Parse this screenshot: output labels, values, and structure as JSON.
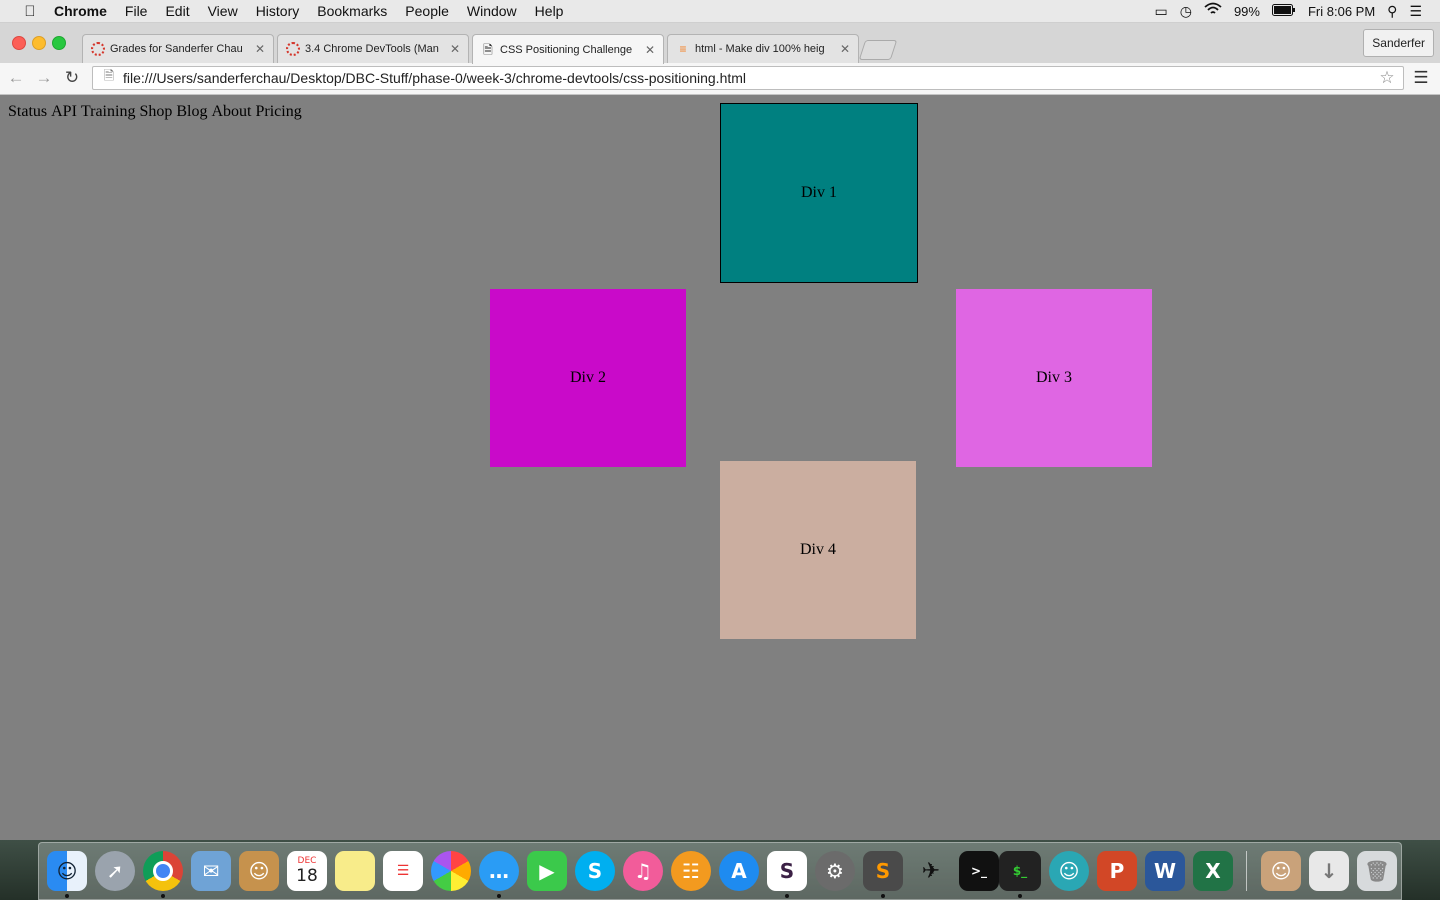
{
  "menubar": {
    "app_name": "Chrome",
    "menus": [
      "File",
      "Edit",
      "View",
      "History",
      "Bookmarks",
      "People",
      "Window",
      "Help"
    ],
    "battery": "99%",
    "clock": "Fri 8:06 PM"
  },
  "browser": {
    "tabs": [
      {
        "title": "Grades for Sanderfer Chau",
        "icon": "ring-icon"
      },
      {
        "title": "3.4 Chrome DevTools (Man",
        "icon": "ring-icon"
      },
      {
        "title": "CSS Positioning Challenge",
        "icon": "page-icon"
      },
      {
        "title": "html - Make div 100% heig",
        "icon": "stackoverflow-icon"
      }
    ],
    "active_tab": 2,
    "profile_name": "Sanderfer",
    "url": "file:///Users/sanderferchau/Desktop/DBC-Stuff/phase-0/week-3/chrome-devtools/css-positioning.html"
  },
  "page": {
    "nav_links": [
      "Status",
      "API",
      "Training",
      "Shop",
      "Blog",
      "About",
      "Pricing"
    ],
    "boxes": {
      "div1": "Div 1",
      "div2": "Div 2",
      "div3": "Div 3",
      "div4": "Div 4"
    },
    "colors": {
      "background": "#808080",
      "div1": "#008080",
      "div2": "#c90ac9",
      "div3": "#df66e3",
      "div4": "#cbaea0"
    }
  },
  "dock": {
    "calendar_month": "DEC",
    "calendar_day": "18",
    "items": [
      "finder-icon",
      "launchpad-icon",
      "chrome-icon",
      "mail-icon",
      "contacts-icon",
      "calendar-icon",
      "notes-icon",
      "reminders-icon",
      "photos-icon",
      "messages-icon",
      "facetime-icon",
      "skype-icon",
      "itunes-icon",
      "ibooks-icon",
      "appstore-icon",
      "slack-icon",
      "system-preferences-icon",
      "sublime-text-icon",
      "gitkraken-icon",
      "terminal-icon",
      "terminal-dark-icon",
      "hipchat-icon",
      "powerpoint-icon",
      "word-icon",
      "excel-icon",
      "user-photo-icon",
      "downloads-icon",
      "trash-icon"
    ]
  }
}
